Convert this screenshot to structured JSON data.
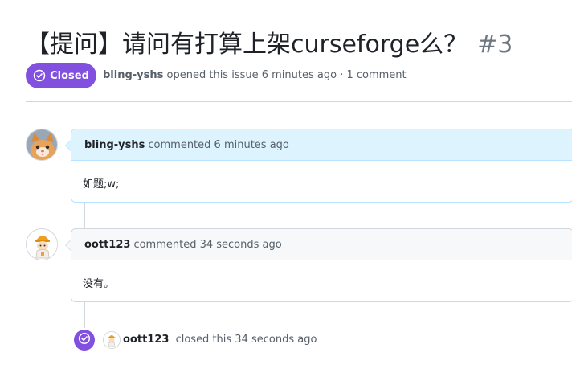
{
  "issue": {
    "title": "【提问】请问有打算上架curseforge么？",
    "number": "#3",
    "state_label": "Closed",
    "author": "bling-yshs",
    "meta_text": "opened this issue 6 minutes ago · 1 comment",
    "state_color": "#8250df"
  },
  "comments": [
    {
      "author": "bling-yshs",
      "action_text": "commented 6 minutes ago",
      "body": "如题;w;",
      "avatar_icon": "cat-avatar-icon"
    },
    {
      "author": "oott123",
      "action_text": "commented 34 seconds ago",
      "body": "没有。",
      "avatar_icon": "cartoon-worker-avatar-icon"
    }
  ],
  "event": {
    "author": "oott123",
    "action_text": "closed this 34 seconds ago",
    "icon": "check-circle-icon"
  }
}
